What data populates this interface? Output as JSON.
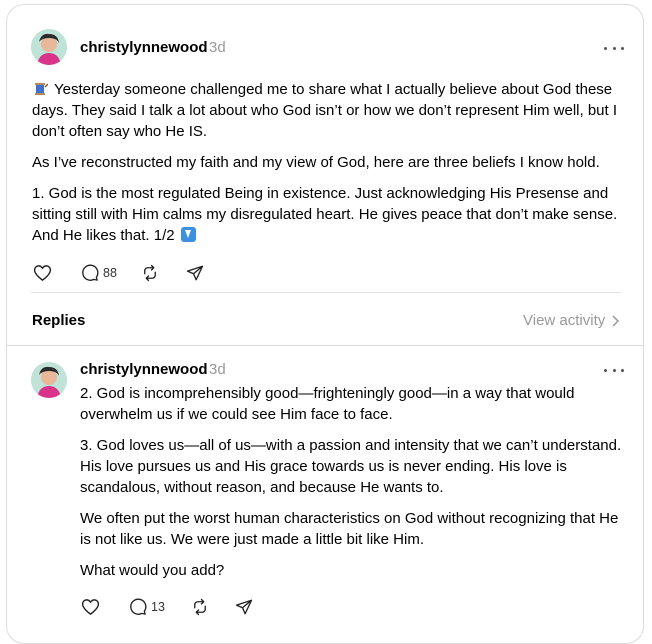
{
  "post": {
    "username": "christylynnewood",
    "time": "3d",
    "paragraphs": [
      "Yesterday someone challenged me to share what I actually believe about God these days. They said I talk a lot about who God isn’t or how we don’t represent Him well, but I don’t often say who He IS.",
      "As I’ve reconstructed my faith and my view of God, here are three beliefs I know hold.",
      "1. God is the most regulated Being in existence. Just acknowledging His Presense and sitting still with Him calms my disregulated heart. He gives peace that don’t make sense. And He likes that. 1/2"
    ],
    "lead_emoji": "thread-spool-emoji",
    "trail_emoji": "down-arrow-emoji",
    "reply_count": "88"
  },
  "replies_header": {
    "label": "Replies",
    "view_activity": "View activity"
  },
  "reply": {
    "username": "christylynnewood",
    "time": "3d",
    "paragraphs": [
      "2. God is incomprehensibly good—frighteningly good—in a way that would overwhelm us if we could see Him face to face.",
      "3. God loves us—all of us—with a passion and intensity that we can’t understand. His love pursues us and His grace towards us is never ending. His love is scandalous, without reason, and because He wants to.",
      "We often put the worst human characteristics on God without recognizing that He is not like us. We were just made a little bit like Him.",
      "What would you add?"
    ],
    "reply_count": "13"
  },
  "colors": {
    "muted_text": "#999999",
    "border": "#dcdcdc",
    "arrow_emoji_blue": "#3d8fe0"
  }
}
